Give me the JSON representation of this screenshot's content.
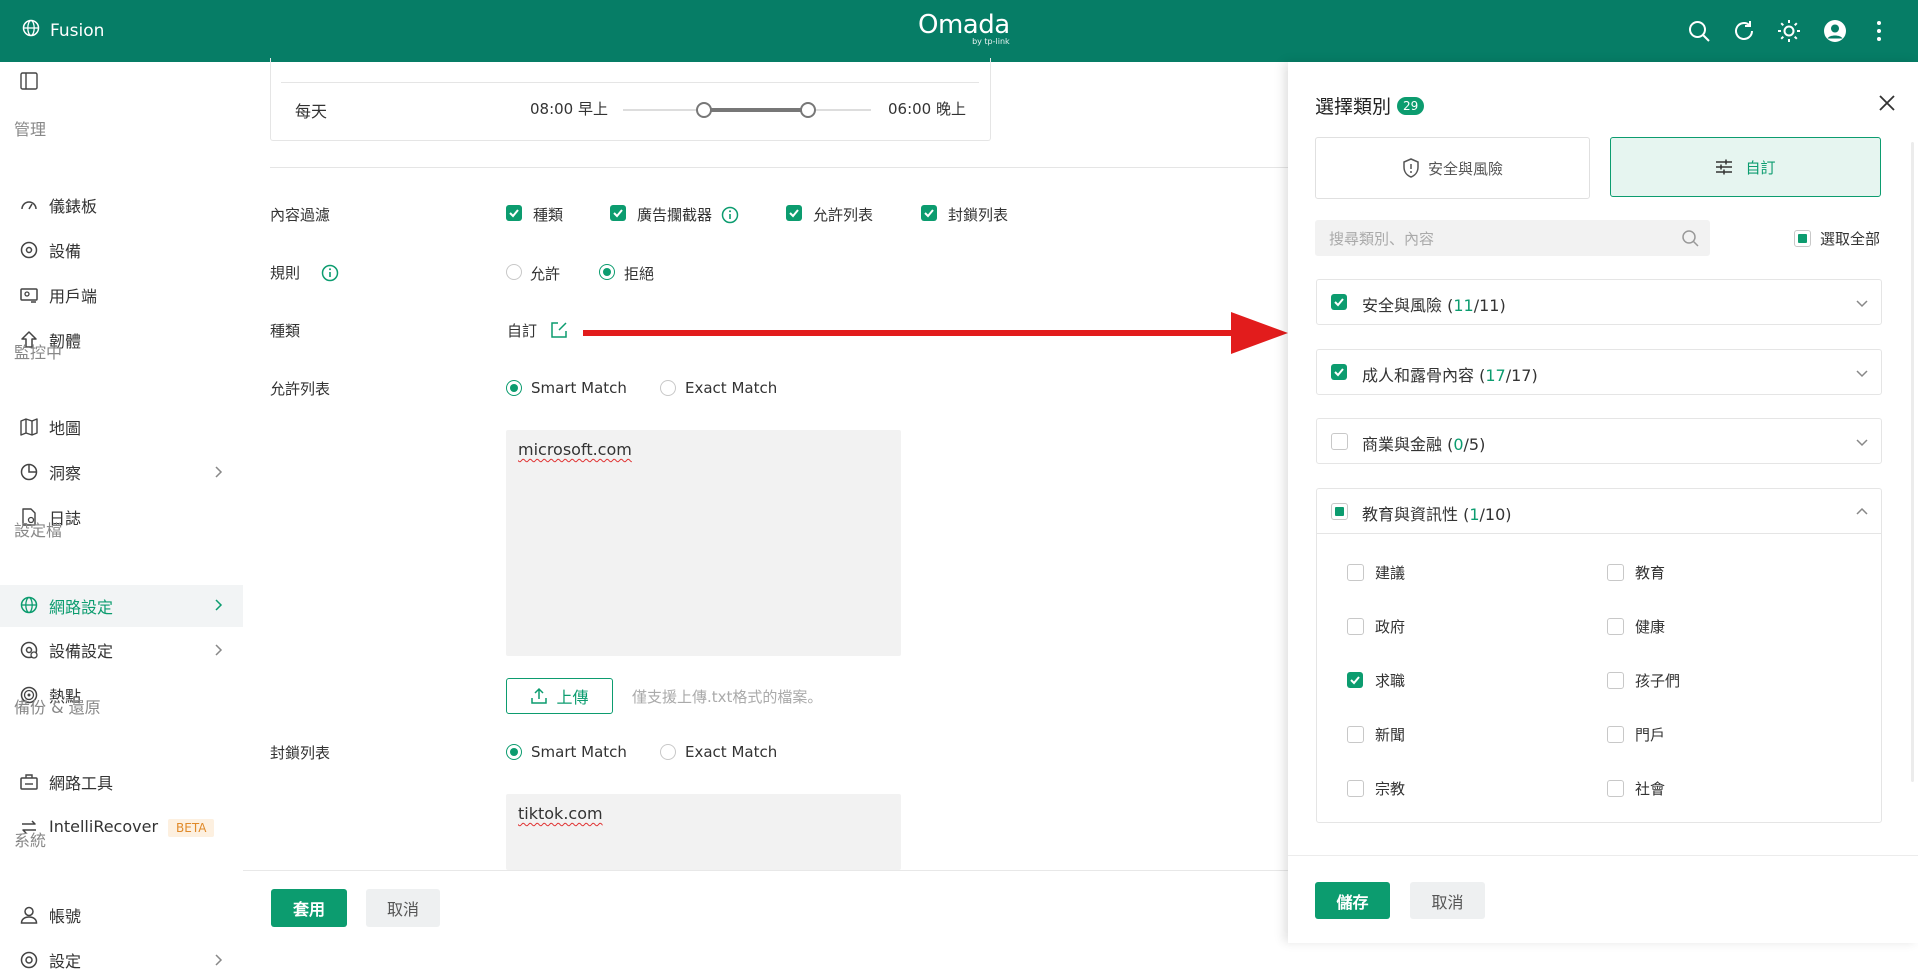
{
  "topbar": {
    "app_name": "Fusion",
    "logo_main": "Omada",
    "logo_sub": "by tp-link",
    "bg_color": "#067d66",
    "icons": [
      "search-icon",
      "refresh-icon",
      "theme-icon",
      "avatar",
      "more-icon"
    ]
  },
  "sidebar": {
    "sections": {
      "manage": "管理",
      "monitor": "監控中",
      "profile": "設定檔",
      "backup": "備份 & 還原",
      "system": "系統"
    },
    "items": {
      "dashboard": "儀錶板",
      "devices": "設備",
      "clients": "用戶端",
      "firmware": "韌體",
      "map": "地圖",
      "insight": "洞察",
      "log": "日誌",
      "network_settings": "網路設定",
      "device_settings": "設備設定",
      "hotspot": "熱點",
      "network_tools": "網路工具",
      "intellirecover": "IntelliRecover",
      "beta": "BETA",
      "account": "帳號",
      "settings": "設定"
    },
    "accent": "#0c9c6f"
  },
  "main": {
    "schedule": {
      "day_label": "每天",
      "start": "08:00 早上",
      "end": "06:00 晚上"
    },
    "content_filter": {
      "label": "內容過濾",
      "options": [
        "種類",
        "廣告攔截器",
        "允許列表",
        "封鎖列表"
      ]
    },
    "rule": {
      "label": "規則",
      "allow": "允許",
      "deny": "拒絕",
      "selected": "拒絕"
    },
    "category": {
      "label": "種類",
      "value": "自訂"
    },
    "allow_list": {
      "label": "允許列表",
      "smart": "Smart Match",
      "exact": "Exact Match",
      "content": "microsoft.com",
      "upload_button": "上傳",
      "upload_hint": "僅支援上傳.txt格式的檔案。"
    },
    "block_list": {
      "label": "封鎖列表",
      "smart": "Smart Match",
      "exact": "Exact Match",
      "content": "tiktok.com"
    },
    "footer": {
      "apply": "套用",
      "cancel": "取消"
    }
  },
  "panel": {
    "title": "選擇類別",
    "count": "29",
    "tabs": [
      "安全與風險",
      "自訂"
    ],
    "active_tab": "自訂",
    "search_placeholder": "搜尋類別、內容",
    "select_all": "選取全部",
    "categories": [
      {
        "name": "安全與風險",
        "count": "11",
        "total": "11",
        "state": "checked"
      },
      {
        "name": "成人和露骨內容",
        "count": "17",
        "total": "17",
        "state": "checked"
      },
      {
        "name": "商業與金融",
        "count": "0",
        "total": "5",
        "state": "empty"
      },
      {
        "name": "教育與資訊性",
        "count": "1",
        "total": "10",
        "state": "partial"
      }
    ],
    "sub_items": [
      {
        "label": "建議",
        "checked": false
      },
      {
        "label": "教育",
        "checked": false
      },
      {
        "label": "政府",
        "checked": false
      },
      {
        "label": "健康",
        "checked": false
      },
      {
        "label": "求職",
        "checked": true
      },
      {
        "label": "孩子們",
        "checked": false
      },
      {
        "label": "新聞",
        "checked": false
      },
      {
        "label": "門戶",
        "checked": false
      },
      {
        "label": "宗教",
        "checked": false
      },
      {
        "label": "社會",
        "checked": false
      }
    ],
    "save": "儲存",
    "cancel": "取消"
  }
}
